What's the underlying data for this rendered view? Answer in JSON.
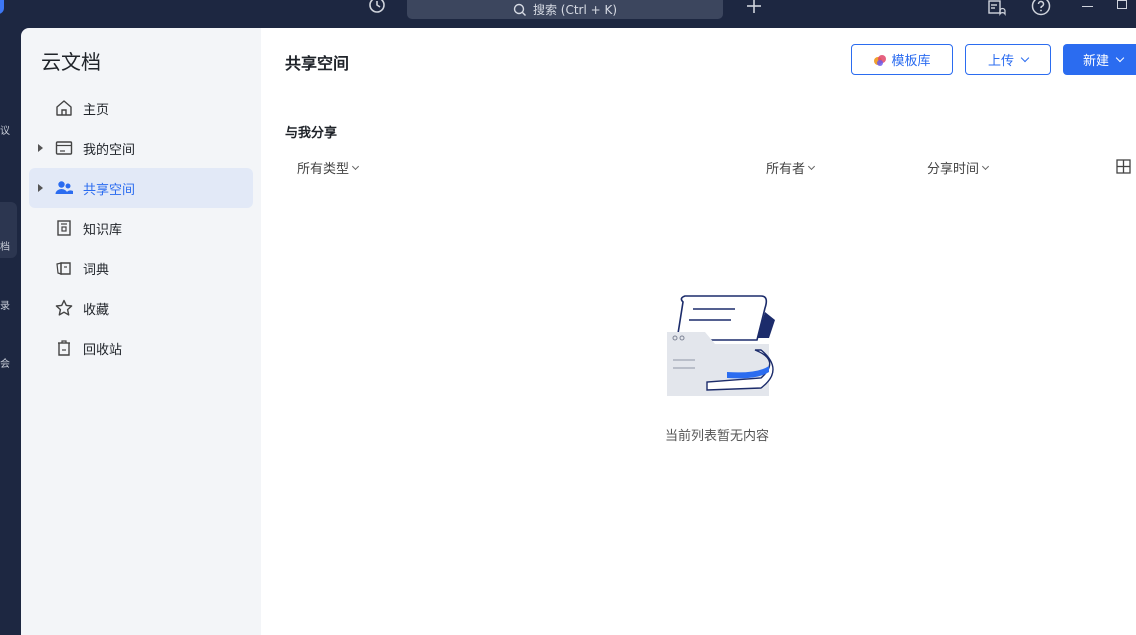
{
  "topbar": {
    "search_placeholder": "搜索 (Ctrl + K)"
  },
  "rail": {
    "items": [
      "议",
      "档",
      "录",
      "会"
    ]
  },
  "sidebar": {
    "title": "云文档",
    "items": [
      {
        "label": "主页",
        "icon": "home-icon",
        "active": false
      },
      {
        "label": "我的空间",
        "icon": "folder-icon",
        "active": false
      },
      {
        "label": "共享空间",
        "icon": "users-icon",
        "active": true
      },
      {
        "label": "知识库",
        "icon": "book-icon",
        "active": false
      },
      {
        "label": "词典",
        "icon": "dictionary-icon",
        "active": false
      },
      {
        "label": "收藏",
        "icon": "star-icon",
        "active": false
      },
      {
        "label": "回收站",
        "icon": "trash-icon",
        "active": false
      }
    ]
  },
  "main": {
    "page_title": "共享空间",
    "buttons": {
      "template": "模板库",
      "upload": "上传",
      "new": "新建"
    },
    "section_title": "与我分享",
    "filters": {
      "type": "所有类型",
      "owner": "所有者",
      "share_time": "分享时间"
    },
    "empty_text": "当前列表暂无内容"
  },
  "colors": {
    "accent": "#2b6cf0",
    "topbar": "#1d2741",
    "sidebar_bg": "#f3f5f8",
    "active_bg": "#e2e9f7"
  }
}
